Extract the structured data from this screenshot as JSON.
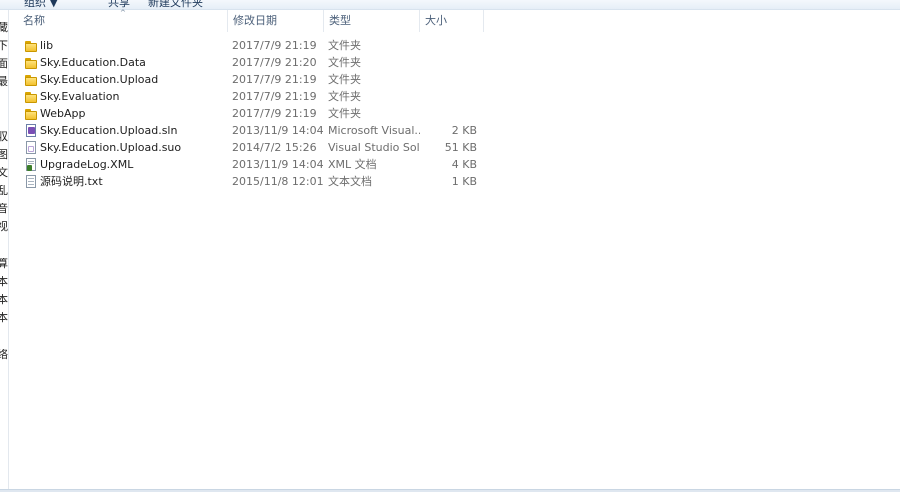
{
  "toolbar": {
    "items": [
      "组织 ▼",
      "共享",
      "新建文件夹"
    ]
  },
  "nav": {
    "chars": [
      "藏",
      "下",
      "面",
      "最",
      "収",
      "图",
      "文",
      "乱",
      "音",
      "视",
      "算",
      "本",
      "本",
      "本",
      "络"
    ]
  },
  "columns": {
    "name": "名称",
    "date": "修改日期",
    "type": "类型",
    "size": "大小",
    "sort_indicator": "^"
  },
  "files": [
    {
      "name": "lib",
      "date": "2017/7/9 21:19",
      "type": "文件夹",
      "size": "",
      "icon": "folder-icon"
    },
    {
      "name": "Sky.Education.Data",
      "date": "2017/7/9 21:20",
      "type": "文件夹",
      "size": "",
      "icon": "folder-icon"
    },
    {
      "name": "Sky.Education.Upload",
      "date": "2017/7/9 21:19",
      "type": "文件夹",
      "size": "",
      "icon": "folder-icon"
    },
    {
      "name": "Sky.Evaluation",
      "date": "2017/7/9 21:19",
      "type": "文件夹",
      "size": "",
      "icon": "folder-icon"
    },
    {
      "name": "WebApp",
      "date": "2017/7/9 21:19",
      "type": "文件夹",
      "size": "",
      "icon": "folder-icon"
    },
    {
      "name": "Sky.Education.Upload.sln",
      "date": "2013/11/9 14:04",
      "type": "Microsoft Visual...",
      "size": "2 KB",
      "icon": "visual-studio-solution-icon"
    },
    {
      "name": "Sky.Education.Upload.suo",
      "date": "2014/7/2 15:26",
      "type": "Visual Studio Sol...",
      "size": "51 KB",
      "icon": "visual-studio-suo-icon"
    },
    {
      "name": "UpgradeLog.XML",
      "date": "2013/11/9 14:04",
      "type": "XML 文档",
      "size": "4 KB",
      "icon": "xml-document-icon"
    },
    {
      "name": "源码说明.txt",
      "date": "2015/11/8 12:01",
      "type": "文本文档",
      "size": "1 KB",
      "icon": "text-document-icon"
    }
  ]
}
